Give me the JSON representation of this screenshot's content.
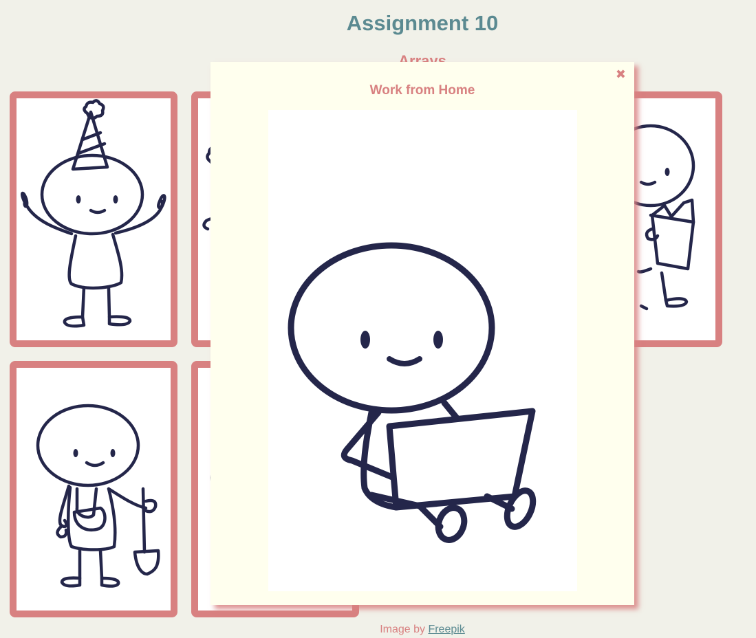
{
  "header": {
    "title": "Assignment 10",
    "subtitle": "Arrays"
  },
  "modal": {
    "title": "Work from Home",
    "close_glyph": "✖",
    "image_icon": "stickman-laptop-illustration"
  },
  "gallery": {
    "cards": [
      {
        "icon": "stickman-party-hat-illustration"
      },
      {
        "icon": "stickman-illustration"
      },
      {
        "icon": "stickman-reading-book-illustration"
      },
      {
        "icon": "stickman-gardener-shovel-illustration"
      },
      {
        "icon": "stickman-illustration"
      }
    ]
  },
  "footer": {
    "prefix": "Image by ",
    "link_text": "Freepik"
  },
  "colors": {
    "background": "#f1f1e9",
    "accent": "#d88181",
    "title": "#5b8a91",
    "modal_bg": "#ffffee",
    "ink": "#24264a"
  }
}
